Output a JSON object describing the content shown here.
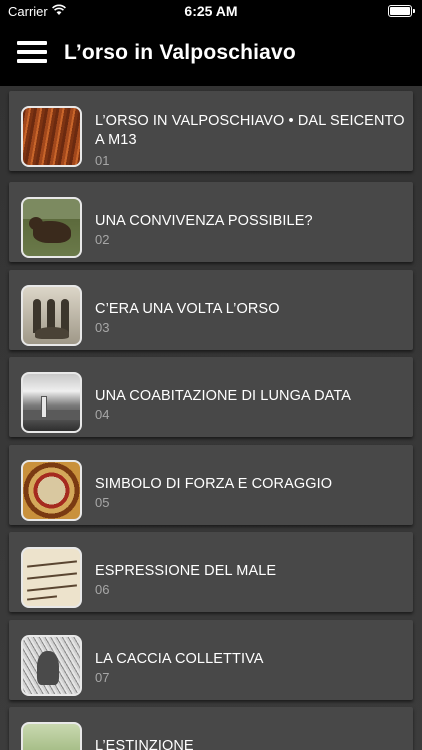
{
  "status_bar": {
    "carrier": "Carrier",
    "time": "6:25 AM",
    "wifi_icon": "wifi-icon",
    "battery_icon": "battery-icon"
  },
  "nav": {
    "menu_icon": "hamburger-menu-icon",
    "title": "L’orso in Valposchiavo"
  },
  "chapters": [
    {
      "title": "L’ORSO IN VALPOSCHIAVO • DAL SEICENTO A M13",
      "number": "01"
    },
    {
      "title": "UNA CONVIVENZA POSSIBILE?",
      "number": "02"
    },
    {
      "title": "C’ERA UNA VOLTA L’ORSO",
      "number": "03"
    },
    {
      "title": "UNA COABITAZIONE DI LUNGA DATA",
      "number": "04"
    },
    {
      "title": "SIMBOLO DI FORZA E CORAGGIO",
      "number": "05"
    },
    {
      "title": "ESPRESSIONE DEL MALE",
      "number": "06"
    },
    {
      "title": "LA CACCIA COLLETTIVA",
      "number": "07"
    },
    {
      "title": "L’ESTINZIONE",
      "number": ""
    }
  ],
  "colors": {
    "background": "#3a3a3a",
    "card": "#484848",
    "bar": "#000000",
    "number_text": "#a7a7a7"
  }
}
